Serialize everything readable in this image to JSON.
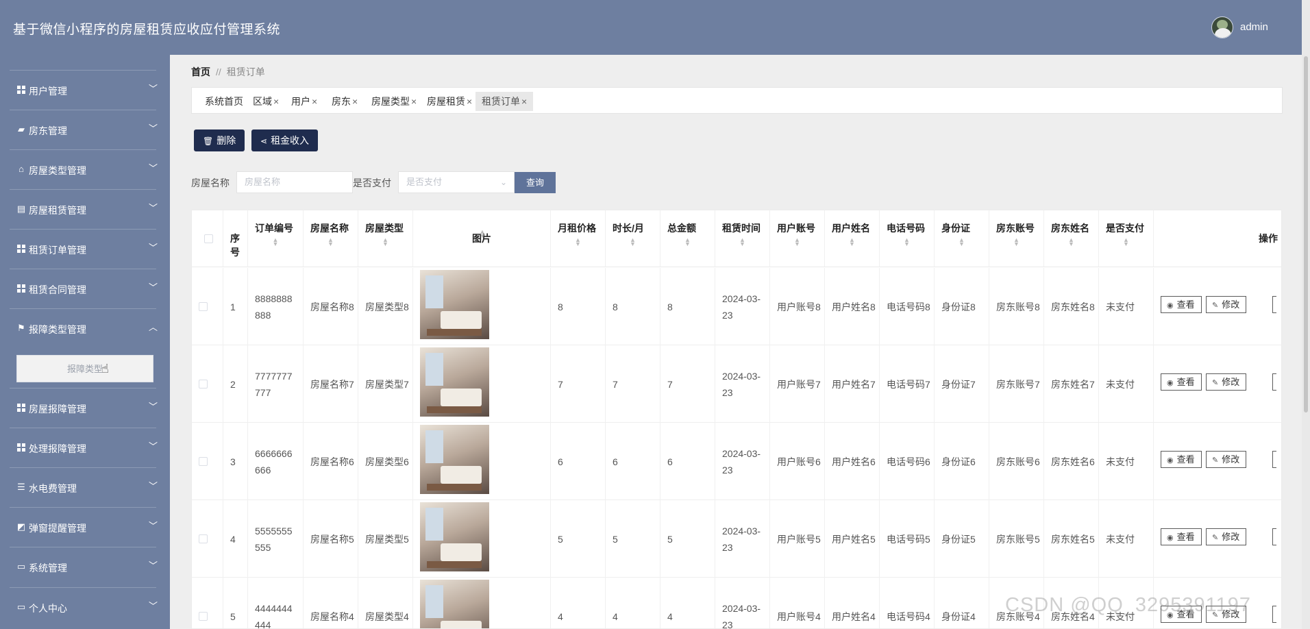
{
  "header": {
    "app_title": "基于微信小程序的房屋租赁应收应付管理系统",
    "user_name": "admin"
  },
  "sidebar": {
    "items": [
      {
        "label": "用户管理",
        "icon": "grid-icon",
        "expanded": false
      },
      {
        "label": "房东管理",
        "icon": "briefcase-icon",
        "expanded": false
      },
      {
        "label": "房屋类型管理",
        "icon": "house-icon",
        "expanded": false
      },
      {
        "label": "房屋租赁管理",
        "icon": "clipboard-icon",
        "expanded": false
      },
      {
        "label": "租赁订单管理",
        "icon": "grid-icon",
        "expanded": false
      },
      {
        "label": "租赁合同管理",
        "icon": "grid-icon",
        "expanded": false
      },
      {
        "label": "报障类型管理",
        "icon": "flag-icon",
        "expanded": true
      },
      {
        "label": "房屋报障管理",
        "icon": "grid-icon",
        "expanded": false
      },
      {
        "label": "处理报障管理",
        "icon": "grid-icon",
        "expanded": false
      },
      {
        "label": "水电费管理",
        "icon": "sliders-icon",
        "expanded": false
      },
      {
        "label": "弹窗提醒管理",
        "icon": "chart-icon",
        "expanded": false
      },
      {
        "label": "系统管理",
        "icon": "monitor-icon",
        "expanded": false
      },
      {
        "label": "个人中心",
        "icon": "window-icon",
        "expanded": false
      }
    ],
    "sub_item_label": "报障类型"
  },
  "breadcrumb": {
    "home": "首页",
    "separator": "//",
    "current": "租赁订单"
  },
  "tabs": [
    {
      "label": "系统首页",
      "closable": false,
      "active": false
    },
    {
      "label": "区域",
      "closable": true,
      "active": false
    },
    {
      "label": "用户",
      "closable": true,
      "active": false
    },
    {
      "label": "房东",
      "closable": true,
      "active": false
    },
    {
      "label": "房屋类型",
      "closable": true,
      "active": false
    },
    {
      "label": "房屋租赁",
      "closable": true,
      "active": false
    },
    {
      "label": "租赁订单",
      "closable": true,
      "active": true
    }
  ],
  "toolbar": {
    "delete_label": "删除",
    "income_label": "租金收入"
  },
  "filters": {
    "house_name_label": "房屋名称",
    "house_name_placeholder": "房屋名称",
    "paid_label": "是否支付",
    "paid_placeholder": "是否支付",
    "query_label": "查询"
  },
  "table": {
    "headers": {
      "index": "序号",
      "order_no": "订单编号",
      "house_name": "房屋名称",
      "house_type": "房屋类型",
      "image": "图片",
      "monthly_rent": "月租价格",
      "duration": "时长/月",
      "total": "总金额",
      "rent_time": "租赁时间",
      "user_account": "用户账号",
      "user_name": "用户姓名",
      "phone": "电话号码",
      "id_card": "身份证",
      "landlord_account": "房东账号",
      "landlord_name": "房东姓名",
      "paid": "是否支付",
      "actions": "操作"
    },
    "view_label": "查看",
    "edit_label": "修改",
    "rows": [
      {
        "index": "1",
        "order_no": "8888888888",
        "house_name": "房屋名称8",
        "house_type": "房屋类型8",
        "monthly_rent": "8",
        "duration": "8",
        "total": "8",
        "rent_time": "2024-03-23",
        "user_account": "用户账号8",
        "user_name": "用户姓名8",
        "phone": "电话号码8",
        "id_card": "身份证8",
        "landlord_account": "房东账号8",
        "landlord_name": "房东姓名8",
        "paid": "未支付"
      },
      {
        "index": "2",
        "order_no": "7777777777",
        "house_name": "房屋名称7",
        "house_type": "房屋类型7",
        "monthly_rent": "7",
        "duration": "7",
        "total": "7",
        "rent_time": "2024-03-23",
        "user_account": "用户账号7",
        "user_name": "用户姓名7",
        "phone": "电话号码7",
        "id_card": "身份证7",
        "landlord_account": "房东账号7",
        "landlord_name": "房东姓名7",
        "paid": "未支付"
      },
      {
        "index": "3",
        "order_no": "6666666666",
        "house_name": "房屋名称6",
        "house_type": "房屋类型6",
        "monthly_rent": "6",
        "duration": "6",
        "total": "6",
        "rent_time": "2024-03-23",
        "user_account": "用户账号6",
        "user_name": "用户姓名6",
        "phone": "电话号码6",
        "id_card": "身份证6",
        "landlord_account": "房东账号6",
        "landlord_name": "房东姓名6",
        "paid": "未支付"
      },
      {
        "index": "4",
        "order_no": "5555555555",
        "house_name": "房屋名称5",
        "house_type": "房屋类型5",
        "monthly_rent": "5",
        "duration": "5",
        "total": "5",
        "rent_time": "2024-03-23",
        "user_account": "用户账号5",
        "user_name": "用户姓名5",
        "phone": "电话号码5",
        "id_card": "身份证5",
        "landlord_account": "房东账号5",
        "landlord_name": "房东姓名5",
        "paid": "未支付"
      },
      {
        "index": "5",
        "order_no": "4444444444",
        "house_name": "房屋名称4",
        "house_type": "房屋类型4",
        "monthly_rent": "4",
        "duration": "4",
        "total": "4",
        "rent_time": "2024-03-23",
        "user_account": "用户账号4",
        "user_name": "用户姓名4",
        "phone": "电话号码4",
        "id_card": "身份证4",
        "landlord_account": "房东账号4",
        "landlord_name": "房东姓名4",
        "paid": "未支付"
      }
    ]
  },
  "watermark": "CSDN @QQ_3295391197",
  "colors": {
    "header_bg": "#6e7fa0",
    "sidebar_bg": "#6e7fa0",
    "dark_button": "#1f2c4e",
    "query_button": "#5f739a"
  }
}
